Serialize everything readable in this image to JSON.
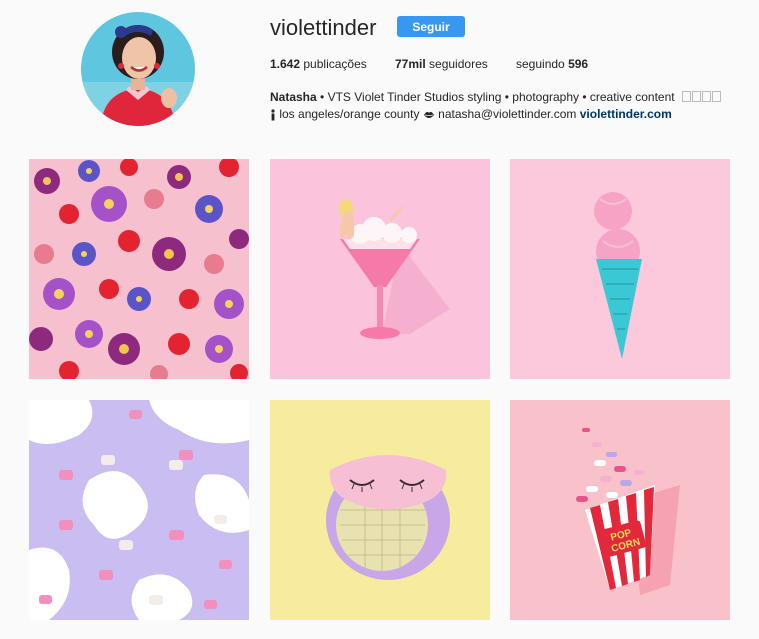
{
  "profile": {
    "username": "violettinder",
    "follow_label": "Seguir"
  },
  "stats": {
    "posts_count": "1.642",
    "posts_label": "publicações",
    "followers_count": "77mil",
    "followers_label": "seguidores",
    "following_label": "seguindo",
    "following_count": "596"
  },
  "bio": {
    "name": "Natasha",
    "separator": " • ",
    "line1_text": "VTS Violet Tinder Studios styling • photography • creative content",
    "line2_location": "los angeles/orange county",
    "line2_email": "natasha@violettinder.com",
    "website": "violettinder.com"
  },
  "posts": [
    {
      "subject": "flowers-pattern",
      "background": "#f7c0cf"
    },
    {
      "subject": "doll-in-cocktail-glass",
      "background": "#fbc4dc"
    },
    {
      "subject": "ice-cream-cone",
      "background": "#fbc9db"
    },
    {
      "subject": "animal-crackers-on-purple",
      "background": "#c9bdf1"
    },
    {
      "subject": "disco-ball-with-sleep-mask",
      "background": "#f7ec9e"
    },
    {
      "subject": "popcorn-box",
      "background": "#f9c2cb"
    }
  ]
}
